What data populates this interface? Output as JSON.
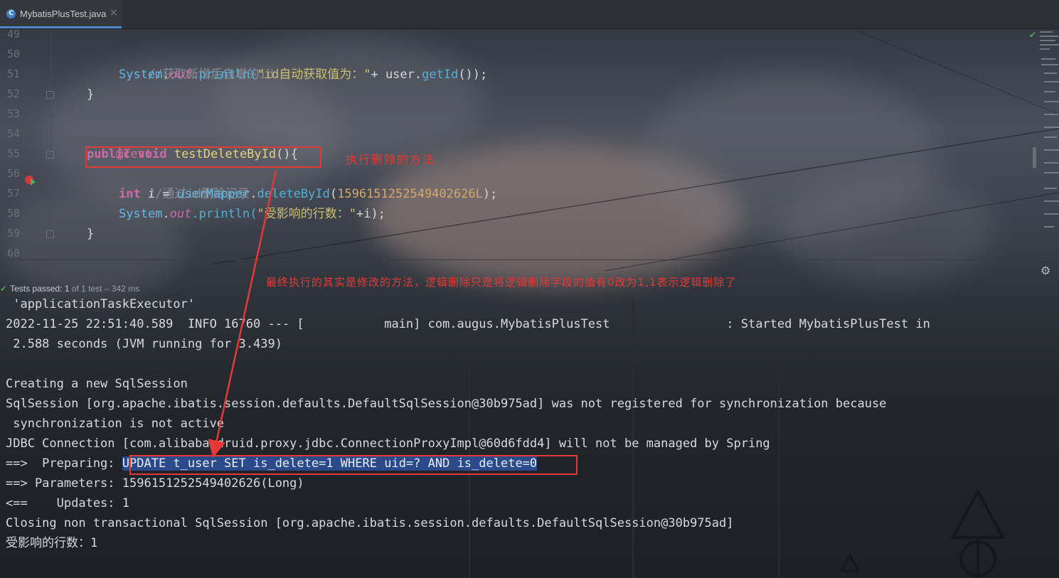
{
  "tab": {
    "icon_letter": "C",
    "label": "MybatisPlusTest.java",
    "close": "×"
  },
  "editor": {
    "line_numbers": [
      "49",
      "50",
      "51",
      "52",
      "53",
      "54",
      "55",
      "56",
      "57",
      "58",
      "59",
      "60"
    ],
    "lines": {
      "l50": "//获取新增后自增的id",
      "l51": {
        "a": "System",
        "b": ".",
        "c": "out",
        "d": ".println(",
        "e": "\"id自动获取值为：\"",
        "f": "+ user.",
        "g": "getId",
        "h": "());"
      },
      "l52": "}",
      "l54": "@Test",
      "l55": {
        "kw": "public void ",
        "name": "testDeleteById",
        "rest": "(){"
      },
      "l56": "//通过id删除记录",
      "l57": {
        "kw": "int ",
        "a": "i = ",
        "b": "userMapper",
        "c": ".",
        "d": "deleteById",
        "e": "(",
        "f": "1596151252549402626L",
        "g": ");"
      },
      "l58": {
        "a": "System",
        "b": ".",
        "c": "out",
        "d": ".println(",
        "e": "\"受影响的行数：\"",
        "f": "+i);"
      },
      "l59": "}"
    },
    "annotation_method": "执行删除的方法"
  },
  "panel": {
    "status_check": "✓",
    "status_text": "Tests passed: ",
    "status_count": "1",
    "status_of": " of 1 test – 342 ms",
    "gear": "⚙",
    "annotation_sql": "最终执行的其实是修改的方法，逻辑删除只是将逻辑删除字段的值有0改为1,1表示逻辑删除了"
  },
  "console": {
    "lines": [
      " 'applicationTaskExecutor'",
      "2022-11-25 22:51:40.589  INFO 16760 --- [           main] com.augus.MybatisPlusTest                : Started MybatisPlusTest in",
      " 2.588 seconds (JVM running for 3.439)",
      "",
      "Creating a new SqlSession",
      "SqlSession [org.apache.ibatis.session.defaults.DefaultSqlSession@30b975ad] was not registered for synchronization because",
      " synchronization is not active",
      "JDBC Connection [com.alibaba.druid.proxy.jdbc.ConnectionProxyImpl@60d6fdd4] will not be managed by Spring",
      "",
      "==> Parameters: 1596151252549402626(Long)",
      "<==    Updates: 1",
      "Closing non transactional SqlSession [org.apache.ibatis.session.defaults.DefaultSqlSession@30b975ad]",
      "受影响的行数：1"
    ],
    "preparing_prefix": "==>  Preparing: ",
    "preparing_sql": "UPDATE t_user SET is_delete=1 WHERE uid=? AND is_delete=0"
  },
  "colors": {
    "annotation": "#e53935",
    "keyword": "#cf6aa8",
    "sql_highlight": "#2b4a8c"
  }
}
